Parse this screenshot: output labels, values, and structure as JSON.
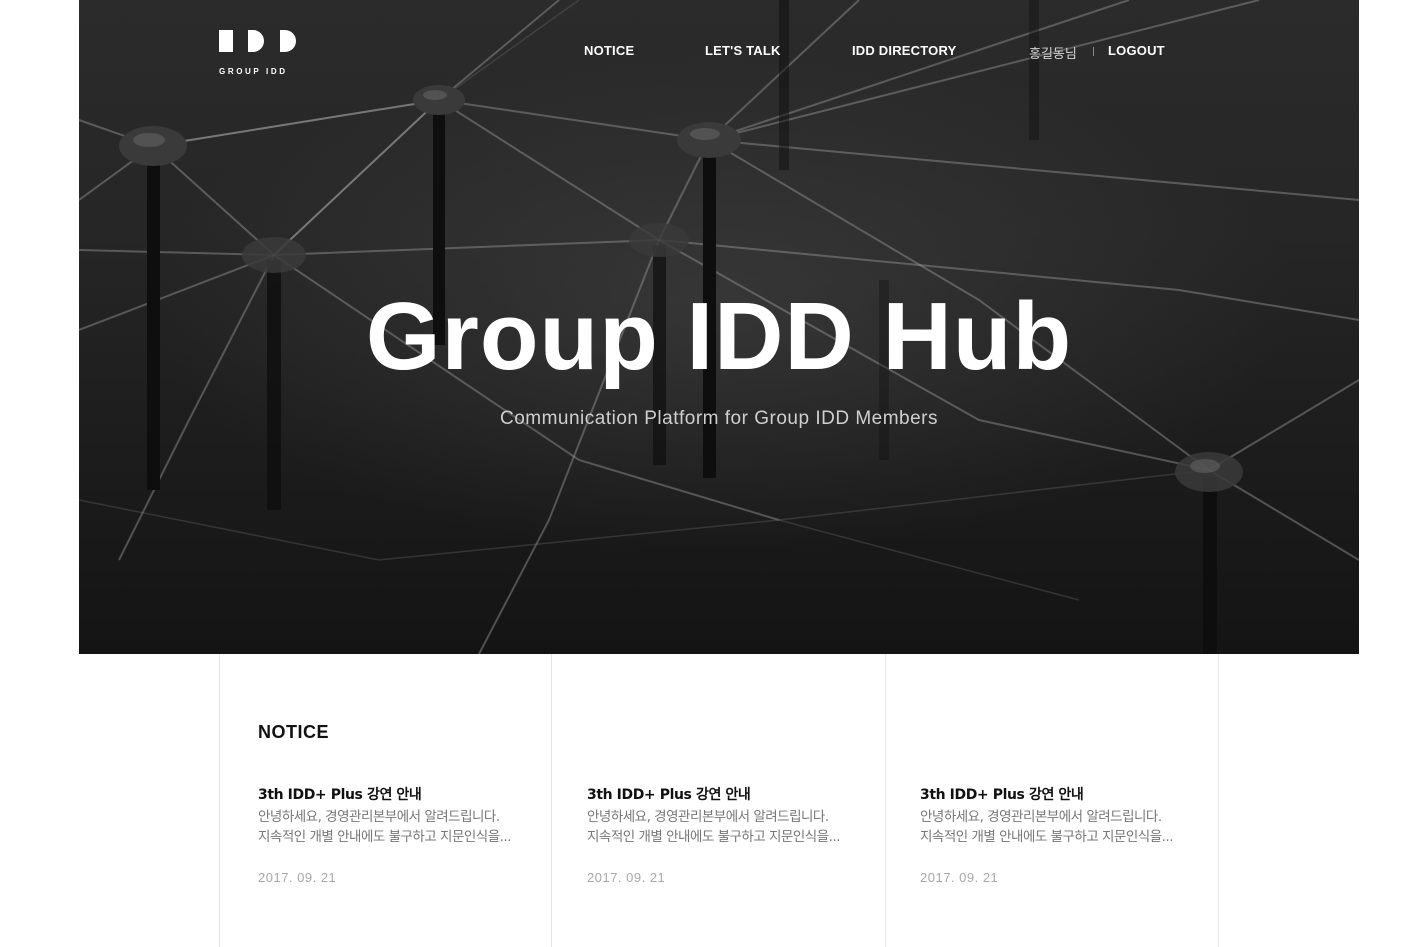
{
  "brand": {
    "logo_text": "GROUP IDD"
  },
  "nav": {
    "notice": "NOTICE",
    "lets_talk": "LET'S TALK",
    "directory": "IDD DIRECTORY",
    "user_name": "홍길동님",
    "logout": "LOGOUT"
  },
  "hero": {
    "title": "Group IDD Hub",
    "subtitle": "Communication Platform for Group IDD Members"
  },
  "notice": {
    "heading": "NOTICE",
    "posts": [
      {
        "title": "3th IDD+ Plus 강연 안내",
        "line1": "안녕하세요, 경영관리본부에서 알려드립니다.",
        "line2": "지속적인 개별 안내에도 불구하고 지문인식을...",
        "date": "2017. 09. 21"
      },
      {
        "title": "3th IDD+ Plus 강연 안내",
        "line1": "안녕하세요, 경영관리본부에서 알려드립니다.",
        "line2": "지속적인 개별 안내에도 불구하고 지문인식을...",
        "date": "2017. 09. 21"
      },
      {
        "title": "3th IDD+ Plus 강연 안내",
        "line1": "안녕하세요, 경영관리본부에서 알려드립니다.",
        "line2": "지속적인 개별 안내에도 불구하고 지문인식을...",
        "date": "2017. 09. 21"
      }
    ]
  },
  "colors": {
    "hero_dark": "#1c1c1c",
    "text_dark": "#111111",
    "text_muted": "#777777",
    "date_gray": "#a8a8a8",
    "divider": "#e6e6e6"
  }
}
